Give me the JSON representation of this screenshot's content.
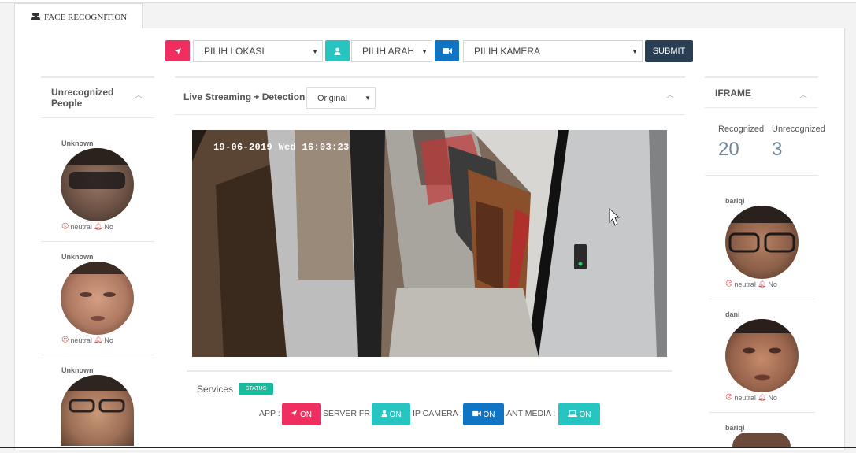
{
  "tab": {
    "label": "FACE RECOGNITION"
  },
  "filters": {
    "location": "PILIH LOKASI",
    "direction": "PILIH ARAH",
    "camera": "PILIH KAMERA",
    "submit": "SUBMIT"
  },
  "left_panel": {
    "title_line1": "Unrecognized",
    "title_line2": "People",
    "people": [
      {
        "name": "Unknown",
        "emotion": "neutral",
        "alert": "No"
      },
      {
        "name": "Unknown",
        "emotion": "neutral",
        "alert": "No"
      },
      {
        "name": "Unknown"
      }
    ]
  },
  "stream": {
    "title": "Live Streaming + Detection",
    "mode": "Original",
    "timestamp": "19-06-2019 Wed 16:03:23"
  },
  "services": {
    "title": "Services",
    "badge": "STATUS",
    "items": [
      {
        "label": "APP :",
        "value": "ON",
        "color": "#ef2f5f"
      },
      {
        "label": "SERVER FR :",
        "value": "ON",
        "color": "#27c5c1"
      },
      {
        "label": "IP CAMERA :",
        "value": "ON",
        "color": "#0f74c4"
      },
      {
        "label": "ANT MEDIA :",
        "value": "ON",
        "color": "#27c5c1"
      }
    ]
  },
  "right_panel": {
    "title": "IFRAME",
    "recognized_label": "Recognized",
    "recognized_count": "20",
    "unrecognized_label": "Unrecognized",
    "unrecognized_count": "3",
    "people": [
      {
        "name": "bariqi",
        "emotion": "neutral",
        "alert": "No"
      },
      {
        "name": "dani",
        "emotion": "neutral",
        "alert": "No"
      },
      {
        "name": "bariqi"
      }
    ]
  },
  "colors": {
    "location_icon_bg": "#ef2f5f",
    "direction_icon_bg": "#27c5c1",
    "camera_icon_bg": "#0f74c4",
    "submit_bg": "#2a3f54",
    "status_badge": "#1abb9c"
  },
  "icons": {
    "tab": "users-icon",
    "location": "location-arrow-icon",
    "direction": "user-icon",
    "camera": "video-camera-icon",
    "emotion": "frown-icon",
    "alert": "bell-icon",
    "ant_media": "laptop-icon"
  }
}
